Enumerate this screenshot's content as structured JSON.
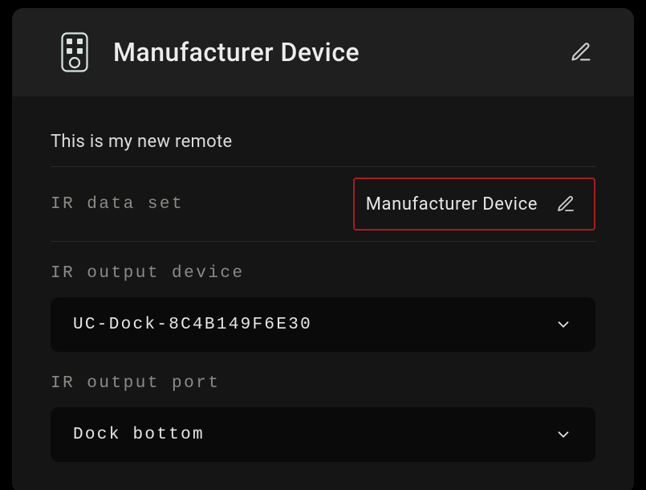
{
  "header": {
    "title": "Manufacturer Device"
  },
  "description": "This is my new remote",
  "fields": {
    "dataset": {
      "label": "IR data set",
      "value": "Manufacturer Device"
    },
    "outputDevice": {
      "label": "IR output device",
      "selected": "UC-Dock-8C4B149F6E30"
    },
    "outputPort": {
      "label": "IR output port",
      "selected": "Dock bottom"
    }
  }
}
